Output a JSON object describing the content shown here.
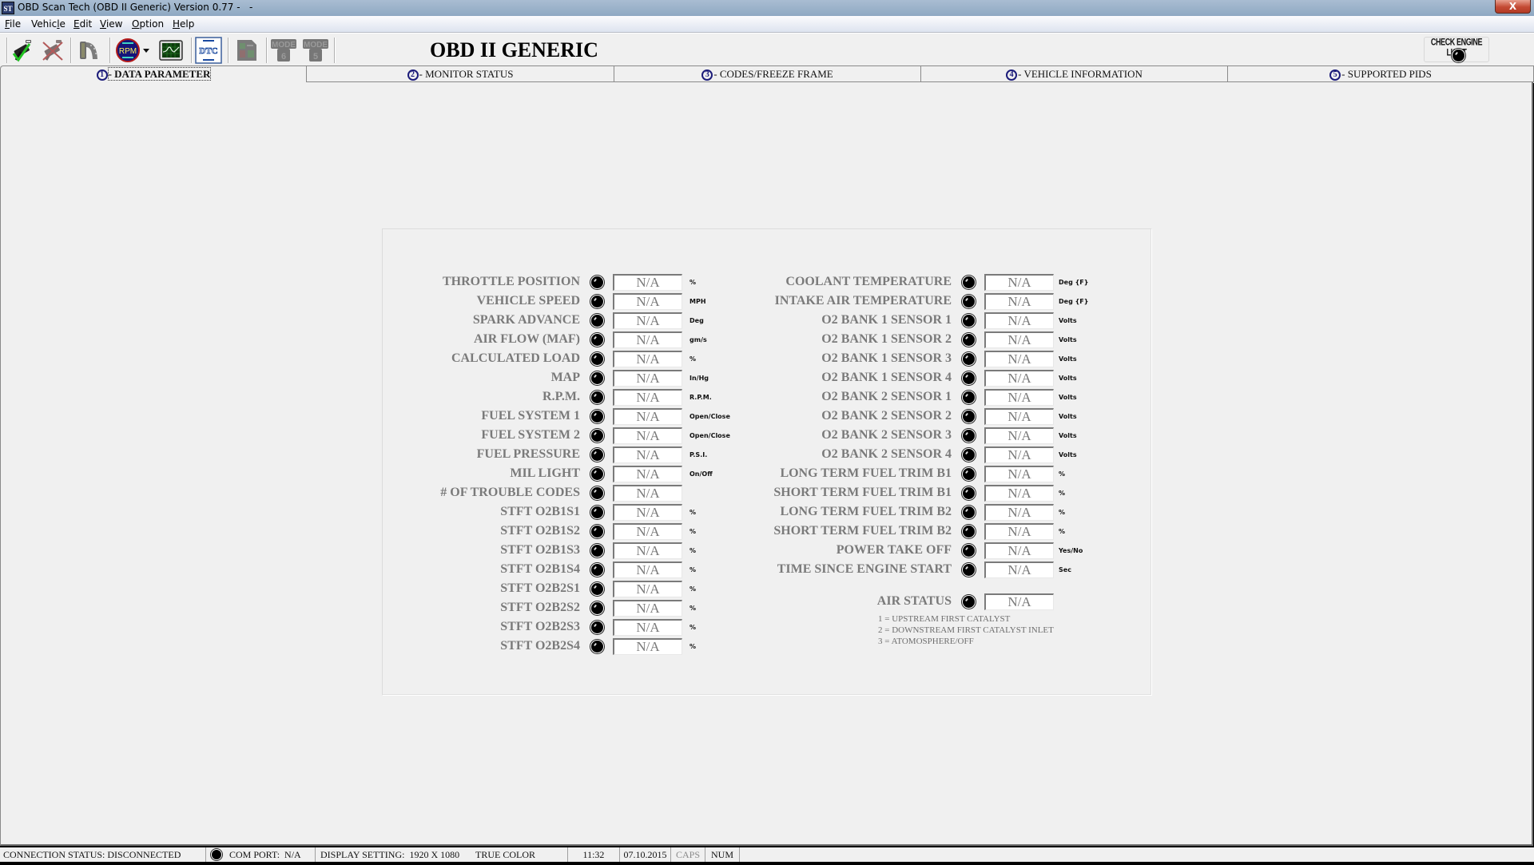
{
  "window": {
    "title": "OBD Scan Tech (OBD II Generic) Version 0.77 -   -",
    "icon_text": "ST",
    "close_label": "X"
  },
  "menu": [
    {
      "label": "File",
      "mnemonic_index": 0
    },
    {
      "label": "Vehicle",
      "mnemonic_index": 5
    },
    {
      "label": "Edit",
      "mnemonic_index": 0
    },
    {
      "label": "View",
      "mnemonic_index": 0
    },
    {
      "label": "Option",
      "mnemonic_index": 0
    },
    {
      "label": "Help",
      "mnemonic_index": 0
    }
  ],
  "toolbar": {
    "buttons": [
      {
        "name": "connect-icon",
        "enabled": true
      },
      {
        "name": "disconnect-icon",
        "enabled": false
      },
      {
        "name": "film-record-icon",
        "enabled": false
      },
      {
        "name": "rpm-gauge-icon",
        "enabled": true,
        "text": "RPM"
      },
      {
        "name": "dropdown-arrow-icon",
        "enabled": true
      },
      {
        "name": "oscilloscope-graph-icon",
        "enabled": true
      },
      {
        "name": "dtc-icon",
        "enabled": true,
        "text": "DTC"
      },
      {
        "name": "report-icon",
        "enabled": false
      },
      {
        "name": "mode6-icon",
        "enabled": false,
        "text": "MODE",
        "sub": "6"
      },
      {
        "name": "mode5-icon",
        "enabled": false,
        "text": "MODE",
        "sub": "5"
      }
    ],
    "heading": "OBD II GENERIC",
    "check_engine_light": {
      "label": "CHECK ENGINE LIGHT",
      "on": false
    }
  },
  "tabs": [
    {
      "num": "1",
      "label": "- DATA PARAMETER",
      "active": true
    },
    {
      "num": "2",
      "label": "- MONITOR STATUS",
      "active": false
    },
    {
      "num": "3",
      "label": "- CODES/FREEZE FRAME",
      "active": false
    },
    {
      "num": "4",
      "label": "- VEHICLE INFORMATION",
      "active": false
    },
    {
      "num": "5",
      "label": "- SUPPORTED PIDS",
      "active": false
    }
  ],
  "parameters": {
    "left": [
      {
        "label": "THROTTLE POSITION",
        "value": "N/A",
        "unit": "%"
      },
      {
        "label": "VEHICLE SPEED",
        "value": "N/A",
        "unit": "MPH"
      },
      {
        "label": "SPARK ADVANCE",
        "value": "N/A",
        "unit": "Deg"
      },
      {
        "label": "AIR FLOW (MAF)",
        "value": "N/A",
        "unit": "gm/s"
      },
      {
        "label": "CALCULATED LOAD",
        "value": "N/A",
        "unit": "%"
      },
      {
        "label": "MAP",
        "value": "N/A",
        "unit": "In/Hg"
      },
      {
        "label": "R.P.M.",
        "value": "N/A",
        "unit": "R.P.M."
      },
      {
        "label": "FUEL SYSTEM 1",
        "value": "N/A",
        "unit": "Open/Close"
      },
      {
        "label": "FUEL SYSTEM 2",
        "value": "N/A",
        "unit": "Open/Close"
      },
      {
        "label": "FUEL PRESSURE",
        "value": "N/A",
        "unit": "P.S.I."
      },
      {
        "label": "MIL LIGHT",
        "value": "N/A",
        "unit": "On/Off"
      },
      {
        "label": "# OF TROUBLE CODES",
        "value": "N/A",
        "unit": ""
      },
      {
        "label": "STFT O2B1S1",
        "value": "N/A",
        "unit": "%"
      },
      {
        "label": "STFT O2B1S2",
        "value": "N/A",
        "unit": "%"
      },
      {
        "label": "STFT O2B1S3",
        "value": "N/A",
        "unit": "%"
      },
      {
        "label": "STFT O2B1S4",
        "value": "N/A",
        "unit": "%"
      },
      {
        "label": "STFT O2B2S1",
        "value": "N/A",
        "unit": "%"
      },
      {
        "label": "STFT O2B2S2",
        "value": "N/A",
        "unit": "%"
      },
      {
        "label": "STFT O2B2S3",
        "value": "N/A",
        "unit": "%"
      },
      {
        "label": "STFT O2B2S4",
        "value": "N/A",
        "unit": "%"
      }
    ],
    "right": [
      {
        "label": "COOLANT TEMPERATURE",
        "value": "N/A",
        "unit": "Deg {F}"
      },
      {
        "label": "INTAKE AIR TEMPERATURE",
        "value": "N/A",
        "unit": "Deg {F}"
      },
      {
        "label": "O2 BANK 1 SENSOR 1",
        "value": "N/A",
        "unit": "Volts"
      },
      {
        "label": "O2 BANK 1 SENSOR 2",
        "value": "N/A",
        "unit": "Volts"
      },
      {
        "label": "O2 BANK 1 SENSOR 3",
        "value": "N/A",
        "unit": "Volts"
      },
      {
        "label": "O2 BANK 1 SENSOR 4",
        "value": "N/A",
        "unit": "Volts"
      },
      {
        "label": "O2 BANK 2 SENSOR 1",
        "value": "N/A",
        "unit": "Volts"
      },
      {
        "label": "O2 BANK 2 SENSOR 2",
        "value": "N/A",
        "unit": "Volts"
      },
      {
        "label": "O2 BANK 2 SENSOR 3",
        "value": "N/A",
        "unit": "Volts"
      },
      {
        "label": "O2 BANK 2 SENSOR 4",
        "value": "N/A",
        "unit": "Volts"
      },
      {
        "label": "LONG TERM FUEL TRIM B1",
        "value": "N/A",
        "unit": "%"
      },
      {
        "label": "SHORT TERM FUEL TRIM B1",
        "value": "N/A",
        "unit": "%"
      },
      {
        "label": "LONG TERM FUEL TRIM B2",
        "value": "N/A",
        "unit": "%"
      },
      {
        "label": "SHORT TERM FUEL TRIM B2",
        "value": "N/A",
        "unit": "%"
      },
      {
        "label": "POWER TAKE OFF",
        "value": "N/A",
        "unit": "Yes/No"
      },
      {
        "label": "TIME SINCE ENGINE START",
        "value": "N/A",
        "unit": "Sec"
      }
    ],
    "air_status": {
      "label": "AIR STATUS",
      "value": "N/A"
    },
    "air_status_legend": [
      "1 = UPSTREAM FIRST CATALYST",
      "2 = DOWNSTREAM FIRST CATALYST INLET",
      "3 = ATOMOSPHERE/OFF"
    ]
  },
  "statusbar": {
    "connection": "CONNECTION STATUS: DISCONNECTED",
    "com_port": "COM PORT:  N/A",
    "display_setting": "DISPLAY SETTING:  1920 X 1080",
    "color_mode": "TRUE COLOR",
    "time": "11:32",
    "date": "07.10.2015",
    "caps": "CAPS",
    "num": "NUM"
  }
}
